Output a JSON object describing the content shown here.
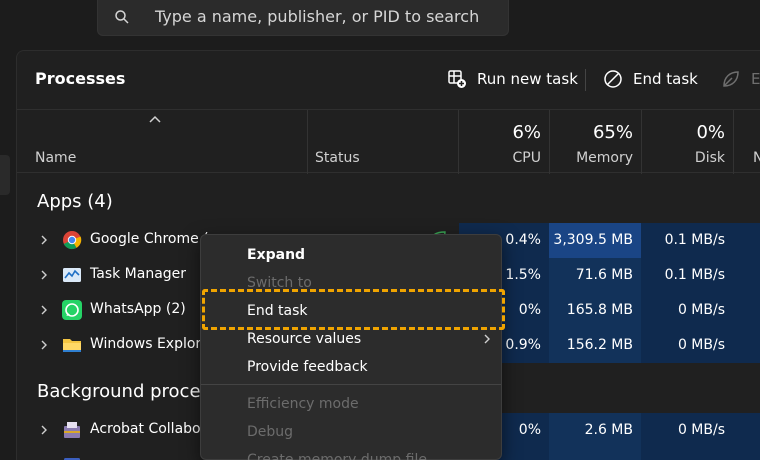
{
  "search": {
    "placeholder": "Type a name, publisher, or PID to search"
  },
  "header": {
    "title": "Processes",
    "run_new_task": "Run new task",
    "end_task": "End task",
    "efficiency_partial": "Ef"
  },
  "columns": {
    "name": "Name",
    "status": "Status",
    "cpu": {
      "pct": "6%",
      "label": "CPU"
    },
    "memory": {
      "pct": "65%",
      "label": "Memory"
    },
    "disk": {
      "pct": "0%",
      "label": "Disk"
    },
    "network_partial": "N"
  },
  "groups": {
    "apps": "Apps (4)",
    "background": "Background proces"
  },
  "apps": [
    {
      "name": "Google Chrome (",
      "cpu": "0.4%",
      "memory": "3,309.5 MB",
      "disk": "0.1 MB/s"
    },
    {
      "name": "Task Manager",
      "cpu": "1.5%",
      "memory": "71.6 MB",
      "disk": "0.1 MB/s"
    },
    {
      "name": "WhatsApp (2)",
      "cpu": "0%",
      "memory": "165.8 MB",
      "disk": "0 MB/s"
    },
    {
      "name": "Windows Explore",
      "cpu": "0.9%",
      "memory": "156.2 MB",
      "disk": "0 MB/s"
    }
  ],
  "background": [
    {
      "name": "Acrobat Collabo",
      "cpu": "0%",
      "memory": "2.6 MB",
      "disk": "0 MB/s"
    }
  ],
  "context_menu": {
    "expand": "Expand",
    "switch_to": "Switch to",
    "end_task": "End task",
    "resource_values": "Resource values",
    "provide_feedback": "Provide feedback",
    "efficiency_mode": "Efficiency mode",
    "debug": "Debug",
    "create_dump": "Create memory dump file"
  },
  "colors": {
    "highlight": "#f0a400",
    "cell_heat_high": "#1a4585",
    "cell_heat_low": "#12325a"
  }
}
